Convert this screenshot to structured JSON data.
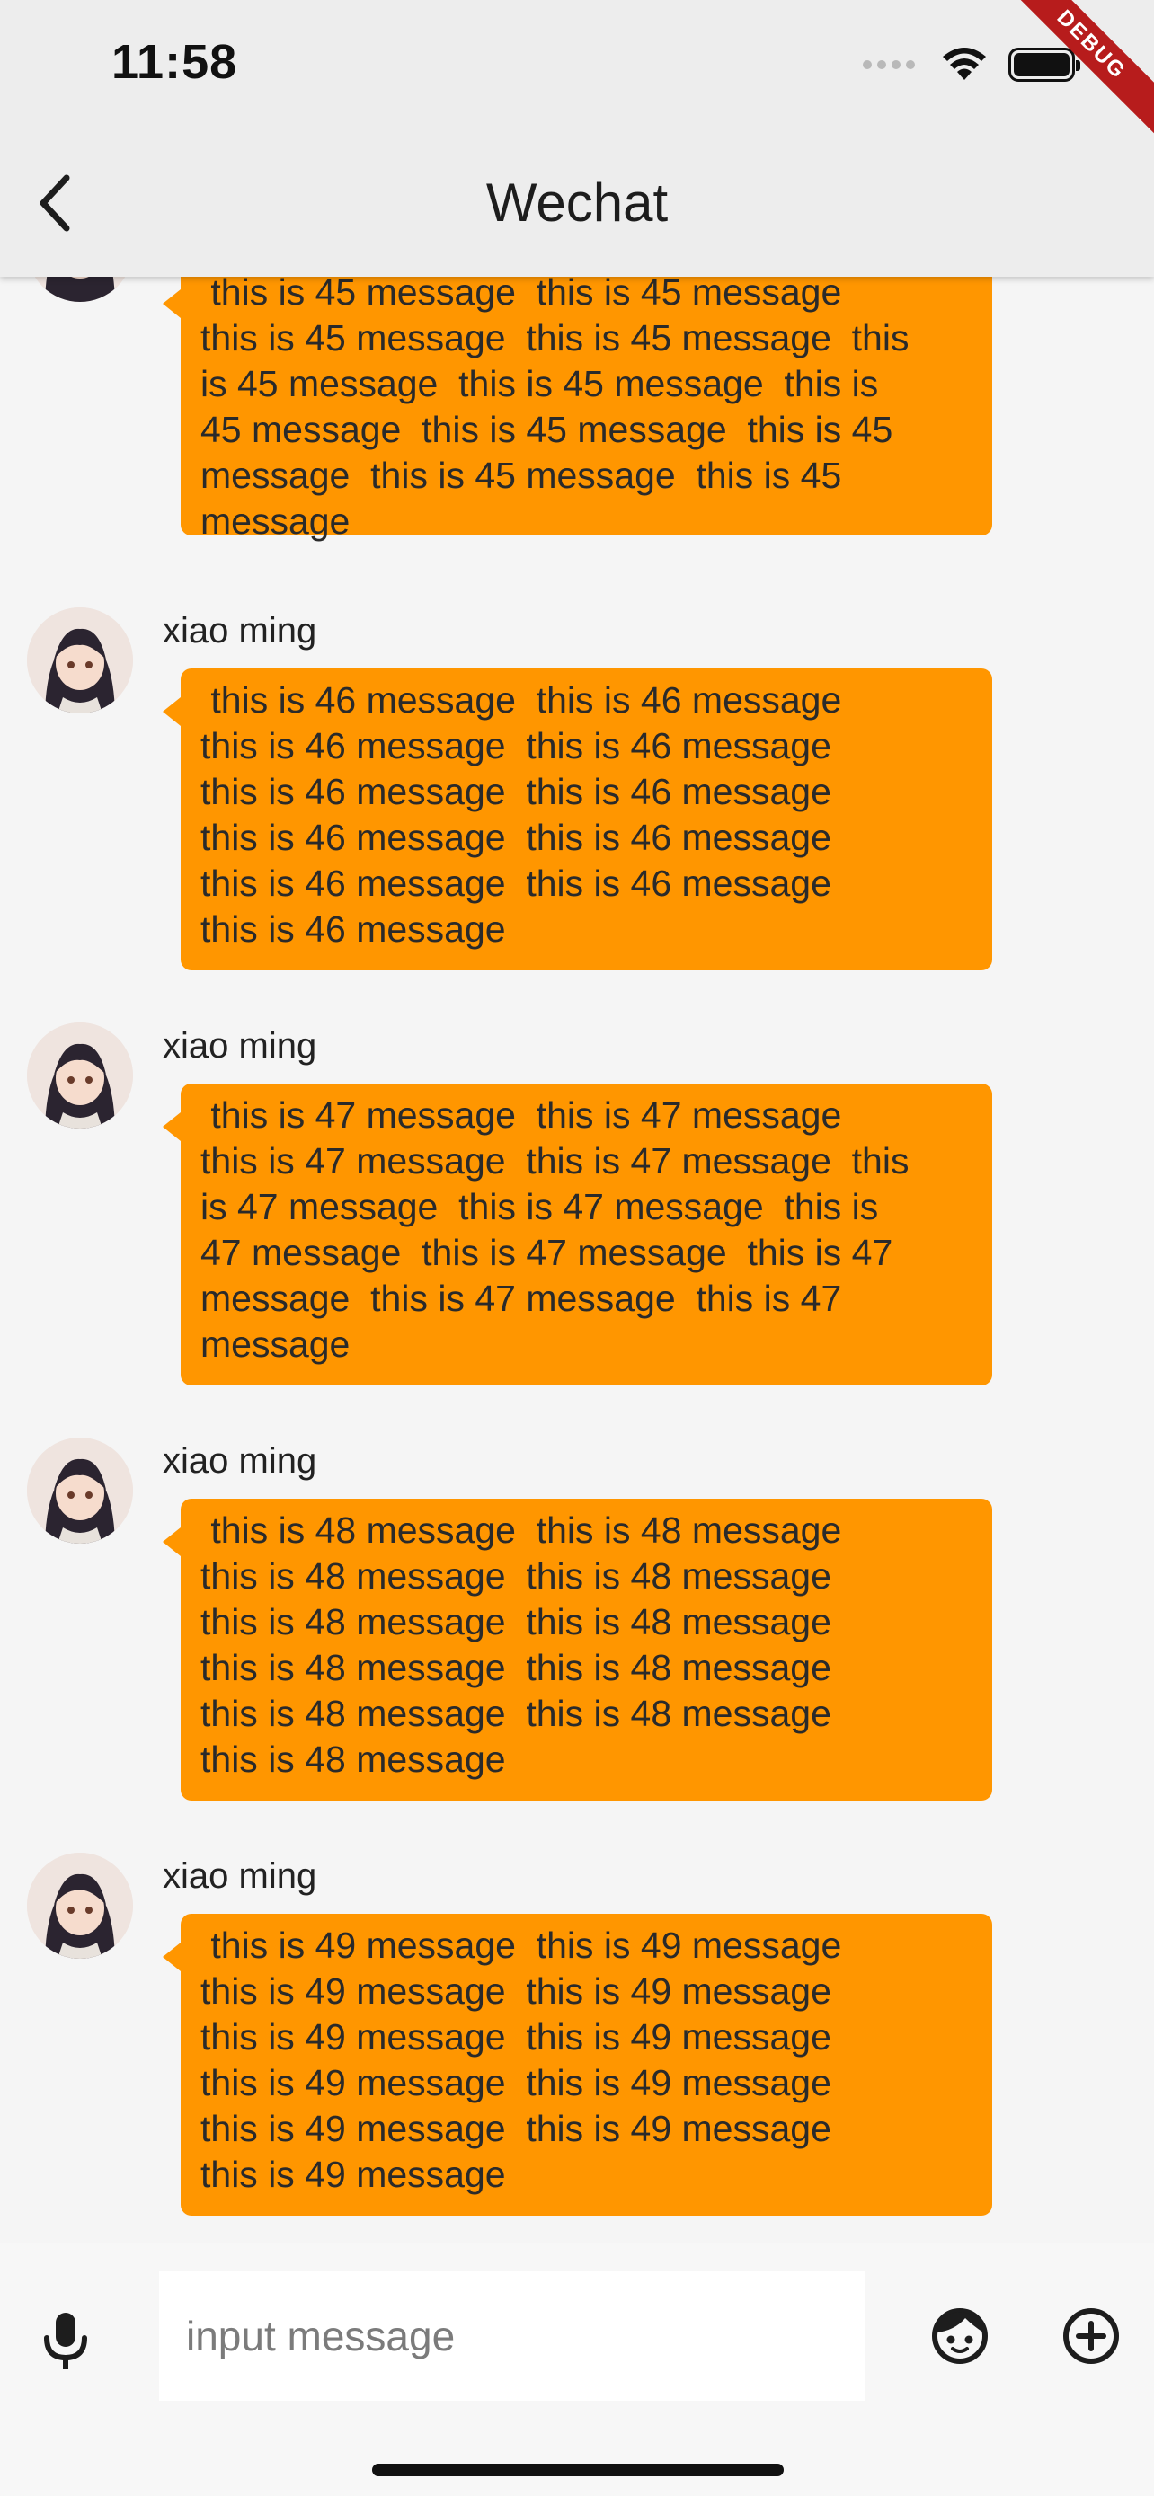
{
  "status_bar": {
    "time": "11:58",
    "debug_label": "DEBUG"
  },
  "app_bar": {
    "title": "Wechat",
    "back_icon": "chevron-left-icon"
  },
  "messages": [
    {
      "sender": "",
      "number": 45,
      "lines": [
        " this is 45 message  this is 45 message",
        "this is 45 message  this is 45 message  this",
        "is 45 message  this is 45 message  this is",
        "45 message  this is 45 message  this is 45",
        "message  this is 45 message  this is 45",
        "message"
      ]
    },
    {
      "sender": "xiao ming",
      "number": 46,
      "lines": [
        " this is 46 message  this is 46 message",
        "this is 46 message  this is 46 message",
        "this is 46 message  this is 46 message",
        "this is 46 message  this is 46 message",
        "this is 46 message  this is 46 message",
        "this is 46 message"
      ]
    },
    {
      "sender": "xiao ming",
      "number": 47,
      "lines": [
        " this is 47 message  this is 47 message",
        "this is 47 message  this is 47 message  this",
        "is 47 message  this is 47 message  this is",
        "47 message  this is 47 message  this is 47",
        "message  this is 47 message  this is 47",
        "message"
      ]
    },
    {
      "sender": "xiao ming",
      "number": 48,
      "lines": [
        " this is 48 message  this is 48 message",
        "this is 48 message  this is 48 message",
        "this is 48 message  this is 48 message",
        "this is 48 message  this is 48 message",
        "this is 48 message  this is 48 message",
        "this is 48 message"
      ]
    },
    {
      "sender": "xiao ming",
      "number": 49,
      "lines": [
        " this is 49 message  this is 49 message",
        "this is 49 message  this is 49 message",
        "this is 49 message  this is 49 message",
        "this is 49 message  this is 49 message",
        "this is 49 message  this is 49 message",
        "this is 49 message"
      ]
    }
  ],
  "input_bar": {
    "placeholder": "input message",
    "value": "",
    "voice_icon": "microphone-icon",
    "emoji_icon": "face-icon",
    "more_icon": "plus-circle-icon"
  },
  "colors": {
    "bubble": "#ff9600",
    "app_bar": "#ededed",
    "background": "#f5f5f5"
  }
}
